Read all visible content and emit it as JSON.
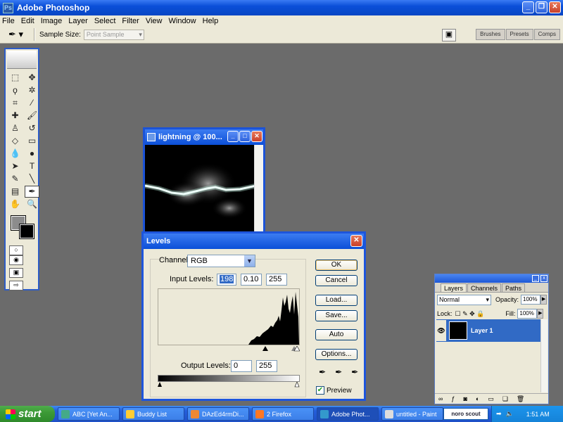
{
  "app": {
    "title": "Adobe Photoshop"
  },
  "menu": [
    "File",
    "Edit",
    "Image",
    "Layer",
    "Select",
    "Filter",
    "View",
    "Window",
    "Help"
  ],
  "options_bar": {
    "sample_size_label": "Sample Size:",
    "sample_size_value": "Point Sample",
    "palette_tabs": [
      "Brushes",
      "Presets",
      "Comps"
    ]
  },
  "document": {
    "title": "lightning @ 100..."
  },
  "levels": {
    "title": "Levels",
    "channel_label": "Channel:",
    "channel_value": "RGB",
    "input_label": "Input Levels:",
    "input_black": "198",
    "input_gamma": "0.10",
    "input_white": "255",
    "output_label": "Output Levels:",
    "output_black": "0",
    "output_white": "255",
    "buttons": {
      "ok": "OK",
      "cancel": "Cancel",
      "load": "Load...",
      "save": "Save...",
      "auto": "Auto",
      "options": "Options..."
    },
    "preview_label": "Preview",
    "preview_checked": true
  },
  "layers_panel": {
    "tabs": [
      "Layers",
      "Channels",
      "Paths"
    ],
    "blend_mode": "Normal",
    "opacity_label": "Opacity:",
    "opacity": "100%",
    "lock_label": "Lock:",
    "fill_label": "Fill:",
    "fill": "100%",
    "layer_name": "Layer 1"
  },
  "taskbar": {
    "start": "start",
    "tasks": [
      "ABC [Yet An...",
      "Buddy List",
      "DAzEd4rmDi...",
      "2 Firefox",
      "Adobe Phot...",
      "untitled - Paint"
    ],
    "tray_logo": "noro scout",
    "clock": "1:51 AM"
  },
  "colors": {
    "title_blue": "#0a4fd8",
    "workspace": "#6b6b6b",
    "selection": "#316ac5"
  }
}
